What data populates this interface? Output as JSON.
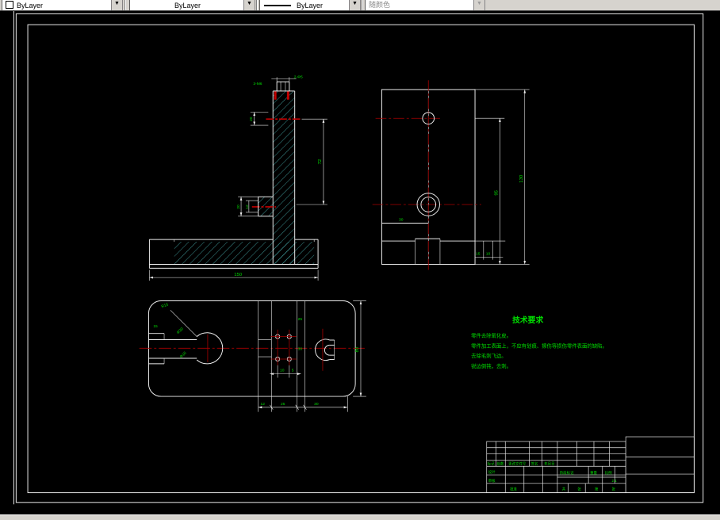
{
  "toolbar": {
    "color_combo": {
      "value": "ByLayer"
    },
    "linetype_combo": {
      "value": "ByLayer"
    },
    "lineweight_combo": {
      "value": "ByLayer"
    },
    "plotstyle_combo": {
      "value": "随颜色"
    }
  },
  "colors": {
    "background": "#000000",
    "paper_line": "#ececec",
    "dimension_green": "#00df00",
    "centerline_red": "#a80000",
    "hatch_cyan": "#56cfcf",
    "toolbar_bg": "#d6d3ce"
  },
  "canvas": {
    "tech_requirements": {
      "title": "技术要求",
      "lines": [
        "零件去除氧化皮。",
        "零件加工表面上，不应有划痕、擦伤等损伤零件表面的缺陷。",
        "去除毛刺飞边。",
        "锐边倒钝，去刺。"
      ]
    },
    "dims": {
      "front": {
        "callout_left": "3-M6",
        "callout_right": "2-Φ5",
        "hole_offset": "20",
        "col_height": "72",
        "flange_outer": "20",
        "flange_inner": "12",
        "base_width": "150"
      },
      "side": {
        "step_width": "30",
        "foot_a": "15",
        "foot_b": "10",
        "inner_height": "95",
        "outer_height": "130"
      },
      "plan": {
        "radius": "R15",
        "slot_width": "15",
        "bore": "Φ30",
        "counterbore": "Φ16",
        "band_top": "25",
        "band_mid": "30",
        "holes_dx": "10",
        "holes_d": "5",
        "height": "80",
        "bottom_a": "12",
        "bottom_b": "25",
        "bottom_c": "30"
      }
    },
    "title_block": {
      "header_row": [
        "标记",
        "处数",
        "更改文件号",
        "签名",
        "年月日"
      ],
      "design": "设计",
      "check": "审核",
      "approve": "批准",
      "stage": "阶段标记",
      "weight": "重量",
      "scale_label": "比例",
      "scale_value": "2:1",
      "sheet": [
        "共",
        "张",
        "第",
        "张"
      ]
    }
  }
}
